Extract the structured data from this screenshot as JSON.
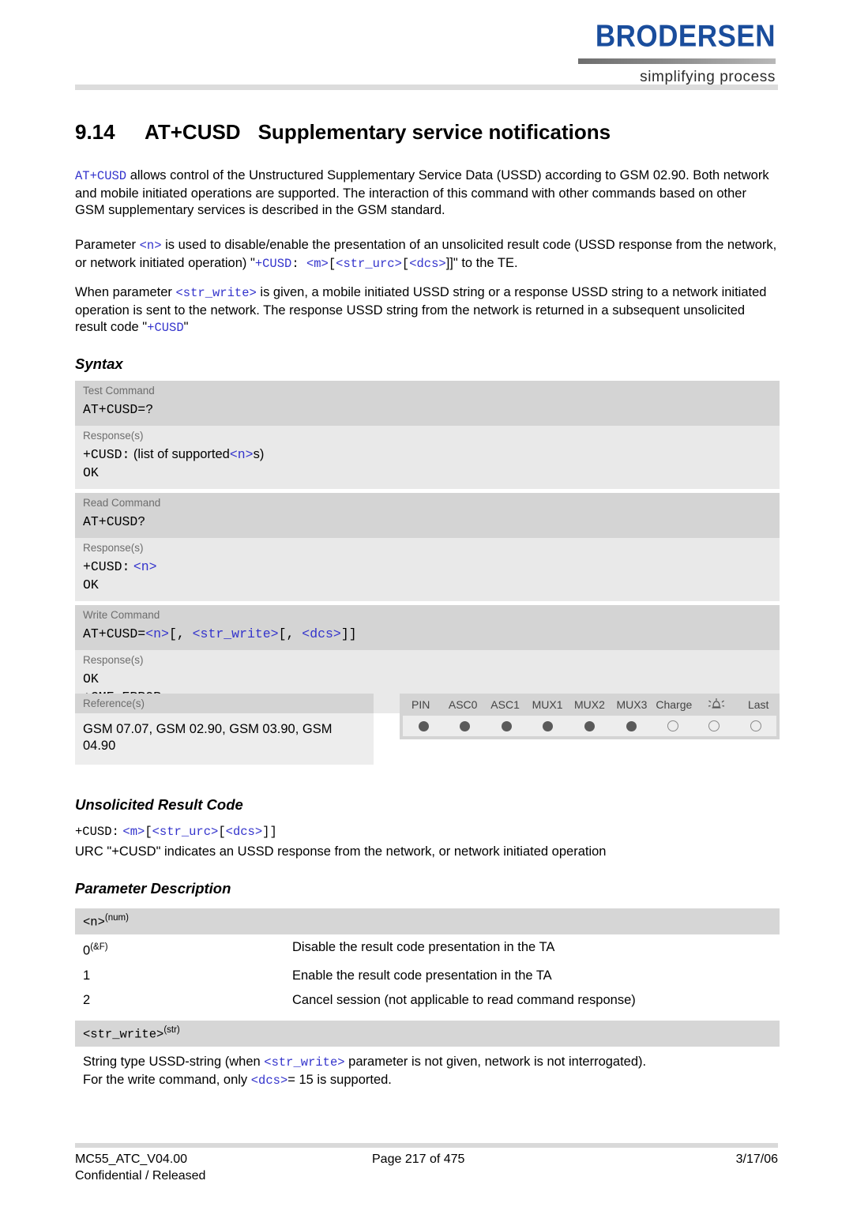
{
  "header": {
    "logo_word": "BRODERSEN",
    "logo_tagline": "simplifying process"
  },
  "title": {
    "number": "9.14",
    "command": "AT+CUSD",
    "text": "Supplementary service notifications"
  },
  "intro": {
    "p1_code": "AT+CUSD",
    "p1_rest": " allows control of the Unstructured Supplementary Service Data (USSD) according to GSM 02.90. Both network and mobile initiated operations are supported. The interaction of this command with other commands based on other GSM supplementary services is described in the GSM standard.",
    "p2_a": "Parameter ",
    "p2_n": "<n>",
    "p2_b": " is used to disable/enable the presentation of an unsolicited result code (USSD response from the network, or network initiated operation) \"",
    "p2_cusd": "+CUSD",
    "p2_c": ": ",
    "p2_m": "<m>",
    "p2_d": "[",
    "p2_strurc": "<str_urc>",
    "p2_dcs": "<dcs>",
    "p2_e": "]]\" to the TE.",
    "p3_a": "When parameter ",
    "p3_strwrite": "<str_write>",
    "p3_b": " is given, a mobile initiated USSD string or a response USSD string to a network initiated operation is sent to the network. The response USSD string from the network is returned in a subsequent unsolicited result code \"",
    "p3_cusd": "+CUSD",
    "p3_c": "\""
  },
  "sections": {
    "syntax": "Syntax",
    "urc": "Unsolicited Result Code",
    "param_desc": "Parameter Description"
  },
  "syntax": {
    "test": {
      "label": "Test Command",
      "code": "AT+CUSD=?",
      "response_label": "Response(s)",
      "resp_cusd": "+CUSD:",
      "resp_text": "(list of supported",
      "resp_n": "<n>",
      "resp_tail": "s)",
      "ok": "OK"
    },
    "read": {
      "label": "Read Command",
      "code": "AT+CUSD?",
      "response_label": "Response(s)",
      "resp_cusd": "+CUSD:",
      "resp_n": "<n>",
      "ok": "OK"
    },
    "write": {
      "label": "Write Command",
      "code_prefix": "AT+CUSD=",
      "code_n": "<n>",
      "code_b1": "[, ",
      "code_strwrite": "<str_write>",
      "code_b2": "[, ",
      "code_dcs": "<dcs>",
      "code_b3": "]]",
      "response_label": "Response(s)",
      "ok": "OK",
      "err": "+CME ERROR"
    }
  },
  "reference": {
    "label": "Reference(s)",
    "text": "GSM 07.07, GSM 02.90, GSM 03.90, GSM 04.90"
  },
  "capability": {
    "columns": [
      "PIN",
      "ASC0",
      "ASC1",
      "MUX1",
      "MUX2",
      "MUX3",
      "Charge",
      "alarm-icon",
      "Last"
    ],
    "values": [
      true,
      true,
      true,
      true,
      true,
      true,
      false,
      false,
      false
    ]
  },
  "urc": {
    "cusd": "+CUSD:",
    "m": "<m>",
    "b1": "[",
    "strurc": "<str_urc>",
    "b2": "[",
    "dcs": "<dcs>",
    "b3": "]]",
    "desc": "URC \"+CUSD\" indicates an USSD response from the network, or network initiated operation"
  },
  "param_n": {
    "name": "<n>",
    "type": "(num)",
    "rows": [
      {
        "key": "0",
        "sup": "(&F)",
        "desc": "Disable the result code presentation in the TA"
      },
      {
        "key": "1",
        "sup": "",
        "desc": "Enable the result code presentation in the TA"
      },
      {
        "key": "2",
        "sup": "",
        "desc": "Cancel session (not applicable to read command response)"
      }
    ]
  },
  "param_strwrite": {
    "name": "<str_write>",
    "type": "(str)",
    "d_a": "String type USSD-string (when ",
    "d_code": "<str_write>",
    "d_b": " parameter is not given, network is not interrogated).",
    "d_c": "For the write command, only ",
    "d_dcs": "<dcs>",
    "d_d": "= 15 is supported."
  },
  "footer": {
    "doc_id": "MC55_ATC_V04.00",
    "confidential": "Confidential / Released",
    "page": "Page 217 of 475",
    "date": "3/17/06"
  }
}
